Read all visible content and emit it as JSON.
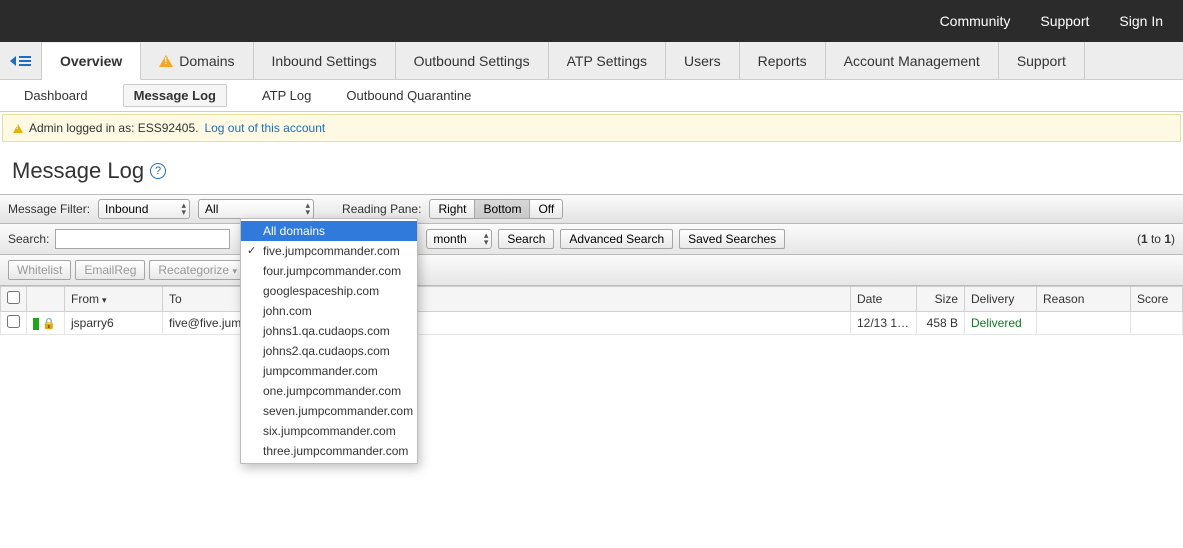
{
  "topbar": {
    "links": [
      "Community",
      "Support",
      "Sign In"
    ]
  },
  "tabs": {
    "items": [
      "Overview",
      "Domains",
      "Inbound Settings",
      "Outbound Settings",
      "ATP Settings",
      "Users",
      "Reports",
      "Account Management",
      "Support"
    ],
    "active_index": 0,
    "domain_warn_index": 1
  },
  "subtabs": {
    "items": [
      "Dashboard",
      "Message Log",
      "ATP Log",
      "Outbound Quarantine"
    ],
    "active_index": 1
  },
  "banner": {
    "text": "Admin logged in as: ESS92405.",
    "link": "Log out of this account"
  },
  "page": {
    "title": "Message Log"
  },
  "filter": {
    "label_filter": "Message Filter:",
    "direction": "Inbound",
    "scope": "All",
    "label_pane": "Reading Pane:",
    "pane_options": [
      "Right",
      "Bottom",
      "Off"
    ],
    "pane_active": 1
  },
  "search": {
    "label": "Search:",
    "value": "",
    "time_range": "month",
    "btn_search": "Search",
    "btn_adv": "Advanced Search",
    "btn_saved": "Saved Searches",
    "count_prefix": "(",
    "count_a": "1",
    "count_mid": " to ",
    "count_b": "1",
    "count_suffix": ")"
  },
  "actions": {
    "whitelist": "Whitelist",
    "emailreg": "EmailReg",
    "recat": "Recategorize"
  },
  "table": {
    "headers": {
      "from": "From",
      "to": "To",
      "date": "Date",
      "size": "Size",
      "delivery": "Delivery",
      "reason": "Reason",
      "score": "Score"
    },
    "rows": [
      {
        "from": "jsparry6",
        "to": "five@five.jumpc",
        "date": "12/13 1…",
        "size": "458 B",
        "delivery": "Delivered",
        "reason": "",
        "score": ""
      }
    ]
  },
  "domain_dropdown": {
    "items": [
      "All domains",
      "five.jumpcommander.com",
      "four.jumpcommander.com",
      "googlespaceship.com",
      "john.com",
      "johns1.qa.cudaops.com",
      "johns2.qa.cudaops.com",
      "jumpcommander.com",
      "one.jumpcommander.com",
      "seven.jumpcommander.com",
      "six.jumpcommander.com",
      "three.jumpcommander.com"
    ],
    "highlighted": 0,
    "checked": 1
  }
}
